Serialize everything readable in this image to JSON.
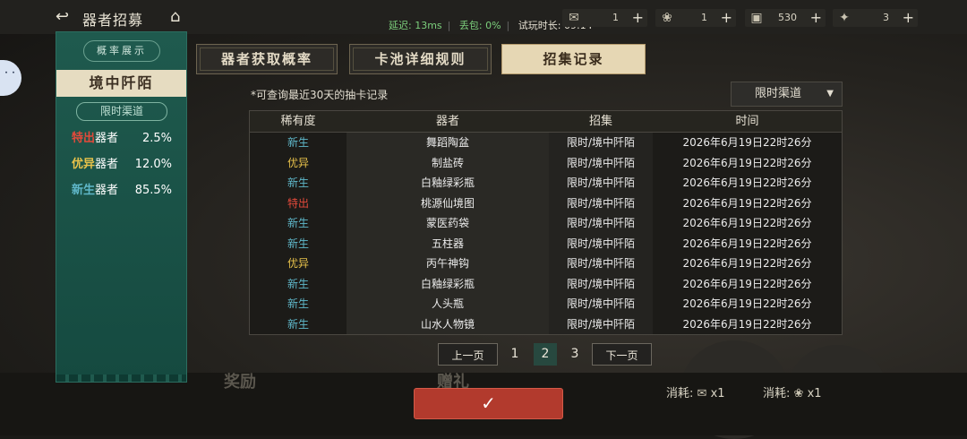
{
  "header": {
    "title": "器者招募",
    "status": {
      "latency": "延迟: 13ms",
      "packet_loss": "丢包: 0%",
      "play_time": "试玩时长: 09:14"
    },
    "resources": [
      {
        "icon": "ticket-icon",
        "value": "1"
      },
      {
        "icon": "token-icon",
        "value": "1"
      },
      {
        "icon": "box-icon",
        "value": "530"
      },
      {
        "icon": "mask-icon",
        "value": "3"
      }
    ],
    "plus_label": "+"
  },
  "left_panel": {
    "tab_label": "概率展示",
    "pool_title": "境中阡陌",
    "channel_label": "限时渠道",
    "rates": [
      {
        "rarity": "特出",
        "word": "器者",
        "percent": "2.5%",
        "color": "#e34a3b"
      },
      {
        "rarity": "优异",
        "word": "器者",
        "percent": "12.0%",
        "color": "#e8c24a"
      },
      {
        "rarity": "新生",
        "word": "器者",
        "percent": "85.5%",
        "color": "#5fb7c9"
      }
    ]
  },
  "tabs": [
    {
      "label": "器者获取概率",
      "active": false
    },
    {
      "label": "卡池详细规则",
      "active": false
    },
    {
      "label": "招集记录",
      "active": true
    }
  ],
  "records": {
    "note": "*可查询最近30天的抽卡记录",
    "filter": "限时渠道",
    "headers": [
      "稀有度",
      "器者",
      "招集",
      "时间"
    ],
    "rows": [
      {
        "rarity": "新生",
        "rarity_color": "#5fb7c9",
        "name": "舞蹈陶盆",
        "pool": "限时/境中阡陌",
        "time": "2026年6月19日22时26分"
      },
      {
        "rarity": "优异",
        "rarity_color": "#e8c24a",
        "name": "制盐砖",
        "pool": "限时/境中阡陌",
        "time": "2026年6月19日22时26分"
      },
      {
        "rarity": "新生",
        "rarity_color": "#5fb7c9",
        "name": "白釉绿彩瓶",
        "pool": "限时/境中阡陌",
        "time": "2026年6月19日22时26分"
      },
      {
        "rarity": "特出",
        "rarity_color": "#e34a3b",
        "name": "桃源仙境图",
        "pool": "限时/境中阡陌",
        "time": "2026年6月19日22时26分"
      },
      {
        "rarity": "新生",
        "rarity_color": "#5fb7c9",
        "name": "蒙医药袋",
        "pool": "限时/境中阡陌",
        "time": "2026年6月19日22时26分"
      },
      {
        "rarity": "新生",
        "rarity_color": "#5fb7c9",
        "name": "五柱器",
        "pool": "限时/境中阡陌",
        "time": "2026年6月19日22时26分"
      },
      {
        "rarity": "优异",
        "rarity_color": "#e8c24a",
        "name": "丙午神钩",
        "pool": "限时/境中阡陌",
        "time": "2026年6月19日22时26分"
      },
      {
        "rarity": "新生",
        "rarity_color": "#5fb7c9",
        "name": "白釉绿彩瓶",
        "pool": "限时/境中阡陌",
        "time": "2026年6月19日22时26分"
      },
      {
        "rarity": "新生",
        "rarity_color": "#5fb7c9",
        "name": "人头瓶",
        "pool": "限时/境中阡陌",
        "time": "2026年6月19日22时26分"
      },
      {
        "rarity": "新生",
        "rarity_color": "#5fb7c9",
        "name": "山水人物镜",
        "pool": "限时/境中阡陌",
        "time": "2026年6月19日22时26分"
      }
    ]
  },
  "pagination": {
    "prev": "上一页",
    "next": "下一页",
    "pages": [
      "1",
      "2",
      "3"
    ],
    "current": "2"
  },
  "footer": {
    "confirm_icon": "✓",
    "costs": [
      {
        "label": "消耗:",
        "icon": "ticket-icon",
        "qty": "x1"
      },
      {
        "label": "消耗:",
        "icon": "token-icon",
        "qty": "x1"
      }
    ],
    "bg_labels": [
      "奖励",
      "赠礼"
    ]
  }
}
